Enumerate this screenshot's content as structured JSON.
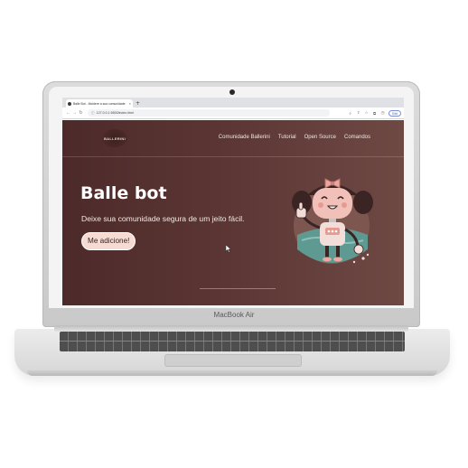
{
  "device": {
    "brand_label": "MacBook Air"
  },
  "browser": {
    "tab_title": "Balle Bot - Moldere a sua comunidade",
    "new_tab_symbol": "+",
    "tab_close_symbol": "×",
    "url": "127.0.0.1:5500/index.html",
    "profile_label": "Edit",
    "icons": [
      "back-arrow-icon",
      "forward-arrow-icon",
      "reload-icon",
      "lock-icon",
      "zoom-icon",
      "share-icon",
      "star-icon",
      "extensions-icon",
      "history-icon"
    ]
  },
  "site": {
    "logo_text": "BALLERINI",
    "nav": [
      {
        "label": "Comunidade Ballerini"
      },
      {
        "label": "Tutorial"
      },
      {
        "label": "Open Source"
      },
      {
        "label": "Comandos"
      }
    ],
    "hero": {
      "title": "Balle bot",
      "subtitle": "Deixe sua comunidade segura de um jeito fácil.",
      "cta_label": "Me adicione!"
    },
    "colors": {
      "background_left": "#4d2a2a",
      "background_right": "#6e4944",
      "cta_background": "#f6dbd2",
      "mascot_pink": "#e9a9a1",
      "mascot_teal": "#5e9a92"
    }
  }
}
